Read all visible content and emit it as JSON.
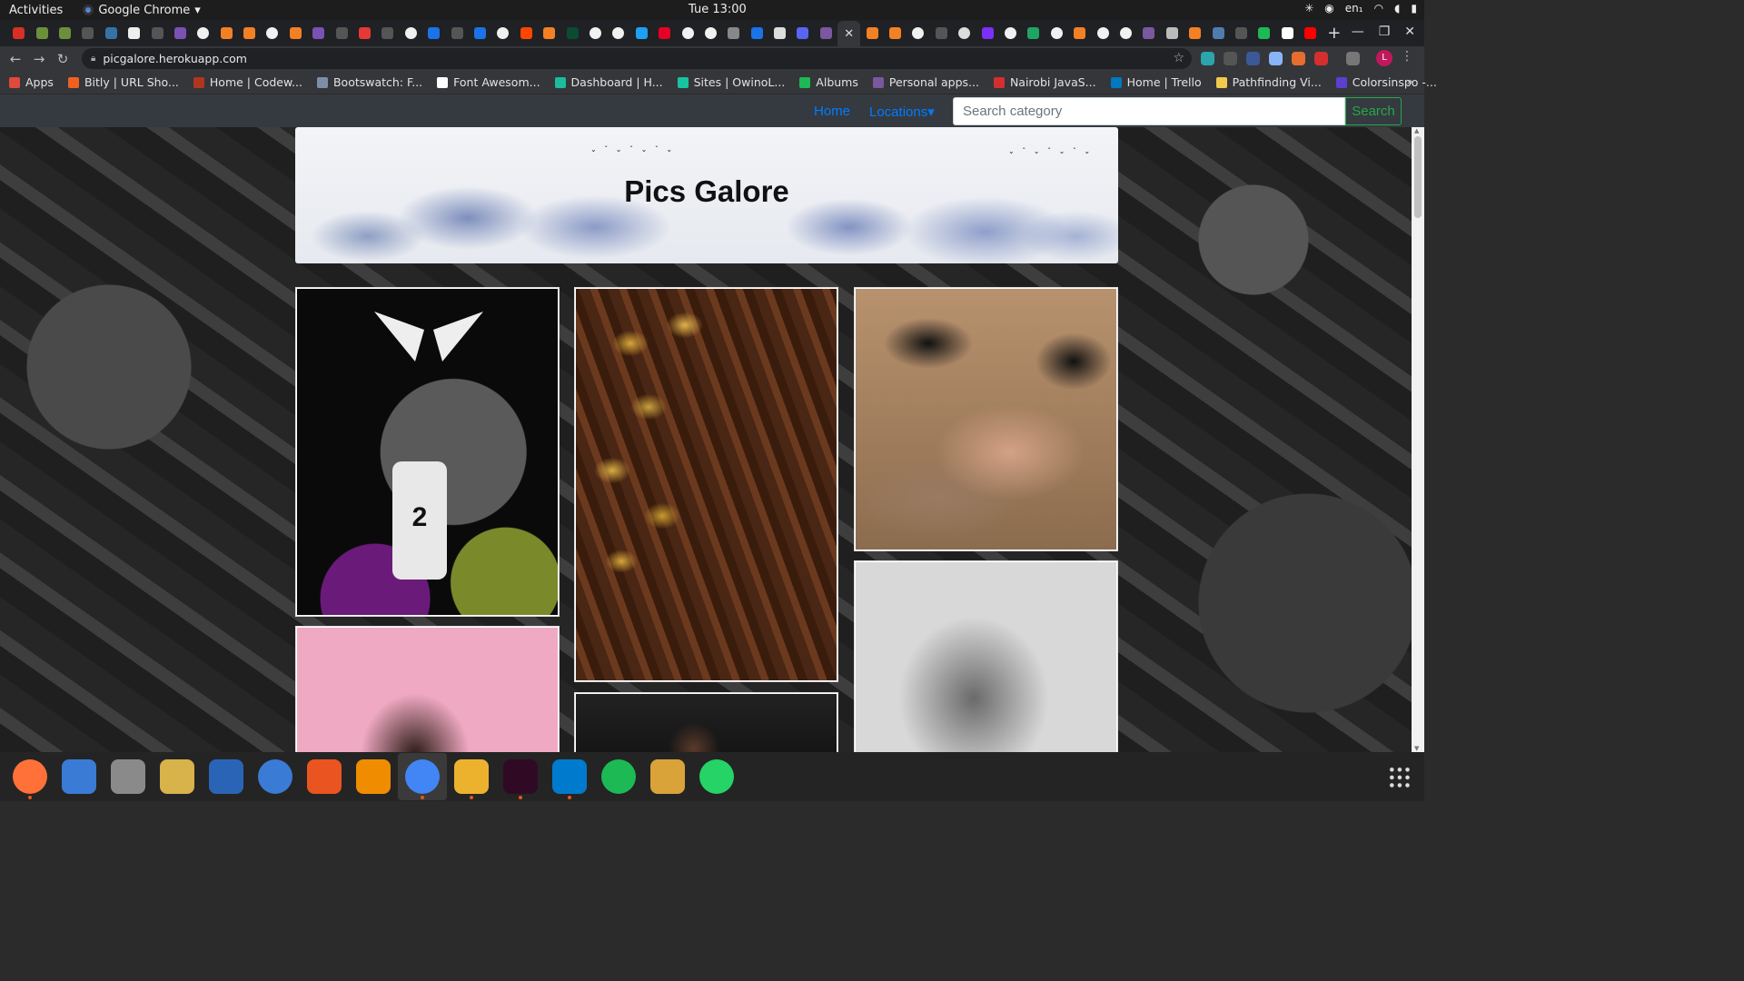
{
  "system_bar": {
    "activities": "Activities",
    "app_name": "Google Chrome",
    "clock": "Tue 13:00",
    "language": "en₁"
  },
  "browser": {
    "url": "picgalore.herokuapp.com",
    "profile_initial": "L",
    "tab_icons": [
      "gmail",
      "tree",
      "tree",
      "github",
      "python",
      "medium",
      "github",
      "b",
      "google",
      "stack",
      "stack",
      "google",
      "stack",
      "bootstrap",
      "github",
      "pin",
      "github",
      "google",
      "blue",
      "github",
      "blue",
      "google",
      "reddit",
      "stack",
      "dj",
      "google",
      "google",
      "twitter",
      "pinterest",
      "google",
      "google",
      "code",
      "blue",
      "cal",
      "video",
      "heroku",
      "close",
      "stack",
      "stack",
      "google",
      "github",
      "circle",
      "tv",
      "google",
      "drive",
      "google",
      "stack",
      "google",
      "google",
      "heroku",
      "mail",
      "stack",
      "db",
      "github",
      "spotify",
      "m",
      "youtube"
    ],
    "bookmarks": [
      {
        "label": "Apps",
        "color": "#e04a3a"
      },
      {
        "label": "Bitly | URL Sho...",
        "color": "#ee6123"
      },
      {
        "label": "Home | Codew...",
        "color": "#b1361e"
      },
      {
        "label": "Bootswatch: F...",
        "color": "#7c8ea8"
      },
      {
        "label": "Font Awesom...",
        "color": "#ffffff"
      },
      {
        "label": "Dashboard | H...",
        "color": "#1abc9c"
      },
      {
        "label": "Sites | OwinoL...",
        "color": "#16c4a0"
      },
      {
        "label": "Albums",
        "color": "#1db954"
      },
      {
        "label": "Personal apps...",
        "color": "#79589f"
      },
      {
        "label": "Nairobi JavaS...",
        "color": "#d32f2f"
      },
      {
        "label": "Home | Trello",
        "color": "#0079bf"
      },
      {
        "label": "Pathfinding Vi...",
        "color": "#f2c94c"
      },
      {
        "label": "Colorsinspo -...",
        "color": "#5b3fd1"
      }
    ]
  },
  "site": {
    "nav": {
      "home": "Home",
      "locations": "Locations",
      "search_placeholder": "Search category",
      "search_button": "Search"
    },
    "title": "Pics Galore",
    "accent": "#007bff",
    "search_color": "#28a745",
    "gallery": [
      {
        "name": "basketball-art",
        "jersey_number": "2"
      },
      {
        "name": "steak-potatoes"
      },
      {
        "name": "tattoo-sneakers"
      },
      {
        "name": "pink-portrait"
      },
      {
        "name": "bw-portrait"
      },
      {
        "name": "basketball-crowd"
      }
    ]
  },
  "dock": [
    {
      "name": "firefox",
      "icon": "firefox-icon",
      "color": "#ff7139"
    },
    {
      "name": "thunderbird",
      "icon": "thunderbird-icon",
      "color": "#3a7bd5"
    },
    {
      "name": "files",
      "icon": "files-icon",
      "color": "#8a8a8a"
    },
    {
      "name": "rhythmbox",
      "icon": "rhythmbox-icon",
      "color": "#d8b24a"
    },
    {
      "name": "writer",
      "icon": "writer-icon",
      "color": "#2a64b7"
    },
    {
      "name": "help",
      "icon": "help-icon",
      "color": "#3a7bd5"
    },
    {
      "name": "software",
      "icon": "software-icon",
      "color": "#e95420"
    },
    {
      "name": "vlc",
      "icon": "vlc-icon",
      "color": "#f08c00"
    },
    {
      "name": "chrome",
      "icon": "chrome-icon",
      "color": "#4285f4"
    },
    {
      "name": "slack",
      "icon": "slack-icon",
      "color": "#ecb22e"
    },
    {
      "name": "terminal",
      "icon": "terminal-icon",
      "color": "#300a24"
    },
    {
      "name": "vscode",
      "icon": "vscode-icon",
      "color": "#007acc"
    },
    {
      "name": "spotify",
      "icon": "spotify-icon",
      "color": "#1db954"
    },
    {
      "name": "csgo",
      "icon": "csgo-icon",
      "color": "#d9a33a"
    },
    {
      "name": "whatsapp",
      "icon": "whatsapp-icon",
      "color": "#25d366"
    }
  ]
}
